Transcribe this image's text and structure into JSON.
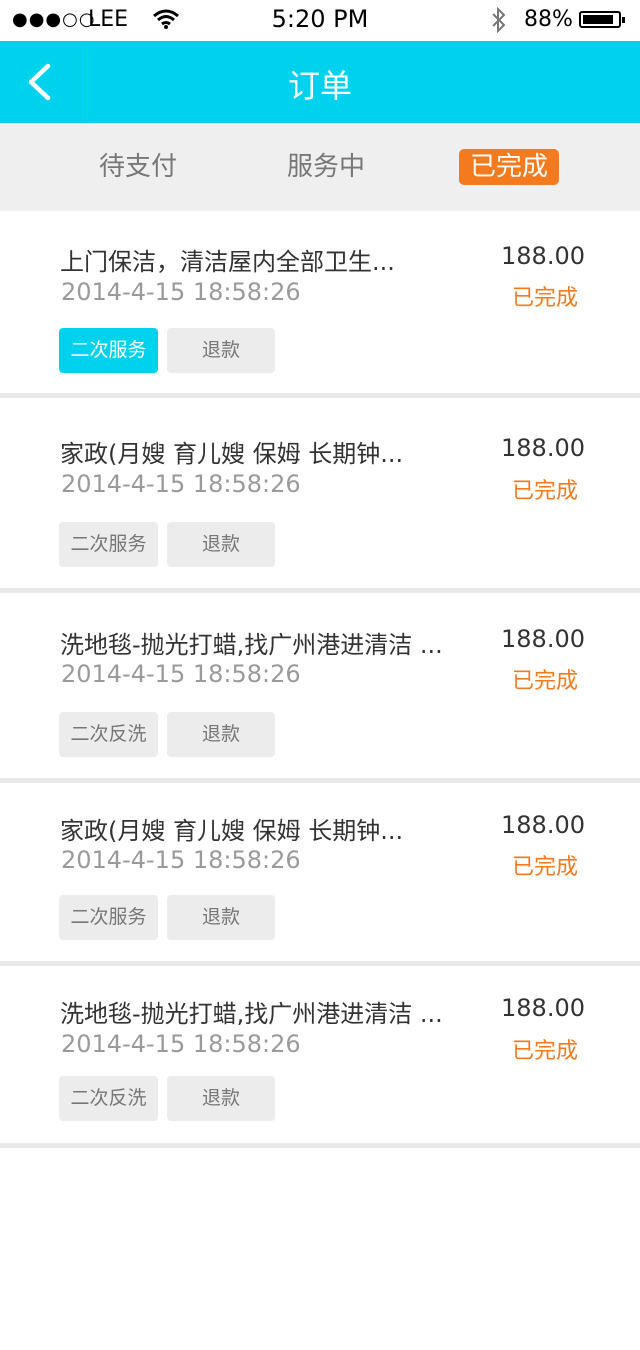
{
  "status_bar": {
    "signal": "●●●○○",
    "carrier": "LEE",
    "time": "5:20 PM",
    "battery_pct": "88%",
    "battery_level": 0.88
  },
  "navbar": {
    "title": "订单",
    "back_icon": "chevron-left-icon"
  },
  "tabs": [
    {
      "label": "待支付",
      "selected": false
    },
    {
      "label": "服务中",
      "selected": false
    },
    {
      "label": "已完成",
      "selected": true
    }
  ],
  "orders": [
    {
      "title": "上门保洁，清洁屋内全部卫生...",
      "datetime": "2014-4-15   18:58:26",
      "price": "188.00",
      "status": "已完成",
      "action1": "二次服务",
      "action1_active": true,
      "action2": "退款"
    },
    {
      "title": "家政(月嫂 育儿嫂 保姆 长期钟...",
      "datetime": "2014-4-15   18:58:26",
      "price": "188.00",
      "status": "已完成",
      "action1": "二次服务",
      "action1_active": false,
      "action2": "退款"
    },
    {
      "title": "洗地毯-抛光打蜡,找广州港进清洁 ...",
      "datetime": "2014-4-15   18:58:26",
      "price": "188.00",
      "status": "已完成",
      "action1": "二次反洗",
      "action1_active": false,
      "action2": "退款"
    },
    {
      "title": "家政(月嫂 育儿嫂 保姆 长期钟...",
      "datetime": "2014-4-15   18:58:26",
      "price": "188.00",
      "status": "已完成",
      "action1": "二次服务",
      "action1_active": false,
      "action2": "退款"
    },
    {
      "title": "洗地毯-抛光打蜡,找广州港进清洁 ...",
      "datetime": "2014-4-15   18:58:26",
      "price": "188.00",
      "status": "已完成",
      "action1": "二次反洗",
      "action1_active": false,
      "action2": "退款"
    }
  ],
  "colors": {
    "accent": "#00d2ee",
    "orange": "#f47a1f",
    "tab_bg": "#efefef",
    "button_bg": "#ececec"
  }
}
